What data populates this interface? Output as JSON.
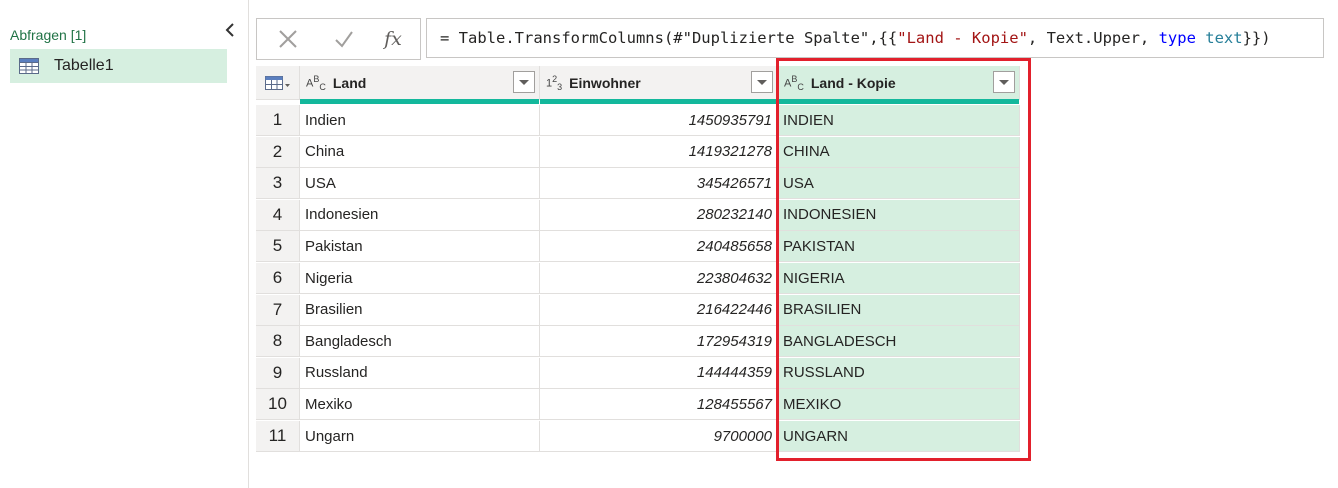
{
  "queries_pane": {
    "header": "Abfragen [1]",
    "collapse_icon": "chevron-left-icon",
    "items": [
      {
        "label": "Tabelle1",
        "icon": "table-icon"
      }
    ]
  },
  "formula_bar": {
    "cancel_icon": "close-icon",
    "confirm_icon": "check-icon",
    "fx_label": "fx",
    "formula_parts": {
      "p1": "= Table.TransformColumns(#\"Duplizierte Spalte\",{{",
      "p2": "\"Land - Kopie\"",
      "p3": ", Text.Upper, ",
      "p4": "type",
      "p5": " ",
      "p6": "text",
      "p7": "}})"
    }
  },
  "table": {
    "corner_icon": "table-menu-icon",
    "columns": [
      {
        "title": "Land",
        "type_icon": "ABC"
      },
      {
        "title": "Einwohner",
        "type_icon": "123"
      },
      {
        "title": "Land - Kopie",
        "type_icon": "ABC"
      }
    ],
    "rows": [
      [
        "1",
        "Indien",
        "1450935791",
        "INDIEN"
      ],
      [
        "2",
        "China",
        "1419321278",
        "CHINA"
      ],
      [
        "3",
        "USA",
        "345426571",
        "USA"
      ],
      [
        "4",
        "Indonesien",
        "280232140",
        "INDONESIEN"
      ],
      [
        "5",
        "Pakistan",
        "240485658",
        "PAKISTAN"
      ],
      [
        "6",
        "Nigeria",
        "223804632",
        "NIGERIA"
      ],
      [
        "7",
        "Brasilien",
        "216422446",
        "BRASILIEN"
      ],
      [
        "8",
        "Bangladesch",
        "172954319",
        "BANGLADESCH"
      ],
      [
        "9",
        "Russland",
        "144444359",
        "RUSSLAND"
      ],
      [
        "10",
        "Mexiko",
        "128455567",
        "MEXIKO"
      ],
      [
        "11",
        "Ungarn",
        "9700000",
        "UNGARN"
      ]
    ]
  },
  "colors": {
    "accent_green": "#217346",
    "selected_fill": "#d6efe0",
    "quality_bar": "#13b89c",
    "highlight_border": "#e2202c"
  }
}
